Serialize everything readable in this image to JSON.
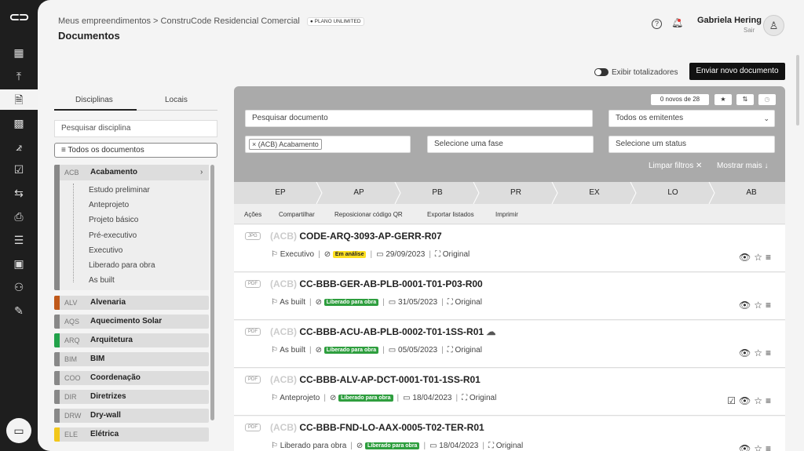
{
  "breadcrumb": "Meus empreendimentos > ConstruCode Residencial Comercial",
  "plan_badge": "PLANO UNLIMITED",
  "page_title": "Documentos",
  "user": {
    "name": "Gabriela Hering",
    "logout": "Sair"
  },
  "toolbar": {
    "toggle_label": "Exibir totalizadores",
    "send_label": "Enviar novo documento"
  },
  "tabs": {
    "disciplines": "Disciplinas",
    "locations": "Locais"
  },
  "search_discipline_placeholder": "Pesquisar disciplina",
  "all_documents": "≡ Todos os documentos",
  "disciplines": [
    {
      "code": "ACB",
      "name": "Acabamento",
      "color": "#888888"
    },
    {
      "code": "ALV",
      "name": "Alvenaria",
      "color": "#c0591a"
    },
    {
      "code": "AQS",
      "name": "Aquecimento Solar",
      "color": "#888888"
    },
    {
      "code": "ARQ",
      "name": "Arquitetura",
      "color": "#22a24a"
    },
    {
      "code": "BIM",
      "name": "BIM",
      "color": "#888888"
    },
    {
      "code": "COO",
      "name": "Coordenação",
      "color": "#888888"
    },
    {
      "code": "DIR",
      "name": "Diretrizes",
      "color": "#888888"
    },
    {
      "code": "DRW",
      "name": "Dry-wall",
      "color": "#888888"
    },
    {
      "code": "ELE",
      "name": "Elétrica",
      "color": "#f2c71a"
    }
  ],
  "phases_list": [
    "Estudo preliminar",
    "Anteprojeto",
    "Projeto básico",
    "Pré-executivo",
    "Executivo",
    "Liberado para obra",
    "As built"
  ],
  "filters": {
    "new_count": "0 novos de 28",
    "search_placeholder": "Pesquisar documento",
    "emitters": "Todos os emitentes",
    "chip": "× (ACB) Acabamento",
    "phase_placeholder": "Selecione uma fase",
    "status_placeholder": "Selecione um status",
    "clear": "Limpar filtros ✕",
    "more": "Mostrar mais ↓"
  },
  "phase_tabs": [
    "EP",
    "AP",
    "PB",
    "PR",
    "EX",
    "LO",
    "AB"
  ],
  "actions": [
    "Ações",
    "Compartilhar",
    "Reposicionar código QR",
    "Exportar listados",
    "Imprimir"
  ],
  "documents": [
    {
      "ext": "JPG",
      "disc": "(ACB)",
      "code": "CODE-ARQ-3093-AP-GERR-R07",
      "phase": "Executivo",
      "status": "Em análise",
      "status_color": "yellow",
      "date": "29/09/2023",
      "version": "Original"
    },
    {
      "ext": "PDF",
      "disc": "(ACB)",
      "code": "CC-BBB-GER-AB-PLB-0001-T01-P03-R00",
      "phase": "As built",
      "status": "Liberado para obra",
      "status_color": "green",
      "date": "31/05/2023",
      "version": "Original"
    },
    {
      "ext": "PDF",
      "disc": "(ACB)",
      "code": "CC-BBB-ACU-AB-PLB-0002-T01-1SS-R01",
      "phase": "As built",
      "status": "Liberado para obra",
      "status_color": "green",
      "date": "05/05/2023",
      "version": "Original"
    },
    {
      "ext": "PDF",
      "disc": "(ACB)",
      "code": "CC-BBB-ALV-AP-DCT-0001-T01-1SS-R01",
      "phase": "Anteprojeto",
      "status": "Liberado para obra",
      "status_color": "green",
      "date": "18/04/2023",
      "version": "Original"
    },
    {
      "ext": "PDF",
      "disc": "(ACB)",
      "code": "CC-BBB-FND-LO-AAX-0005-T02-TER-R01",
      "phase": "Liberado para obra",
      "status": "Liberado para obra",
      "status_color": "green",
      "date": "18/04/2023",
      "version": "Original"
    }
  ]
}
